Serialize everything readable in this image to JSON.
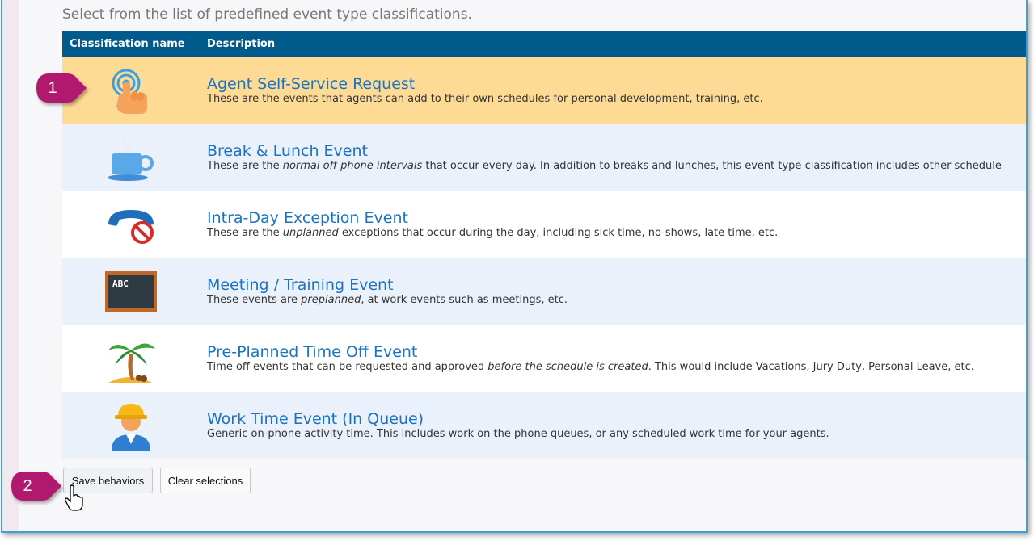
{
  "intro_text": "Select from the list of predefined event type classifications.",
  "table": {
    "headers": [
      "Classification name",
      "Description"
    ],
    "rows": [
      {
        "title": "Agent Self-Service Request",
        "desc": [
          "These are the events that agents can add to their own schedules for personal development, training, etc."
        ],
        "icon": "touch-hand-icon",
        "selected": true
      },
      {
        "title": "Break & Lunch Event",
        "desc": [
          "These are the ",
          "normal off phone intervals",
          " that occur every day. In addition to breaks and lunches, this event type classification includes other schedule"
        ],
        "icon": "coffee-cup-icon",
        "selected": false
      },
      {
        "title": "Intra-Day Exception Event",
        "desc": [
          "These are the ",
          "unplanned",
          " exceptions that occur during the day, including sick time, no-shows, late time, etc."
        ],
        "icon": "phone-blocked-icon",
        "selected": false
      },
      {
        "title": "Meeting / Training Event",
        "desc": [
          "These events are ",
          "preplanned",
          ", at work events such as meetings, etc."
        ],
        "icon": "chalkboard-icon",
        "selected": false
      },
      {
        "title": "Pre-Planned Time Off Event",
        "desc": [
          "Time off events that can be requested and approved ",
          "before the schedule is created",
          ". This would include Vacations, Jury Duty, Personal Leave, etc."
        ],
        "icon": "palm-tree-icon",
        "selected": false
      },
      {
        "title": "Work Time Event (In Queue)",
        "desc": [
          "Generic on-phone activity time. This includes work on the phone queues, or any scheduled work time for your agents."
        ],
        "icon": "worker-icon",
        "selected": false
      }
    ],
    "chalkboard_text": "ABC"
  },
  "buttons": {
    "save": "Save behaviors",
    "clear": "Clear selections"
  },
  "markers": [
    {
      "label": "1"
    },
    {
      "label": "2"
    }
  ],
  "colors": {
    "header": "#005a8c",
    "selected_row": "#fedb94",
    "alt_row": "#eaf1fa",
    "link": "#1a73c1",
    "marker": "#b0196e"
  }
}
